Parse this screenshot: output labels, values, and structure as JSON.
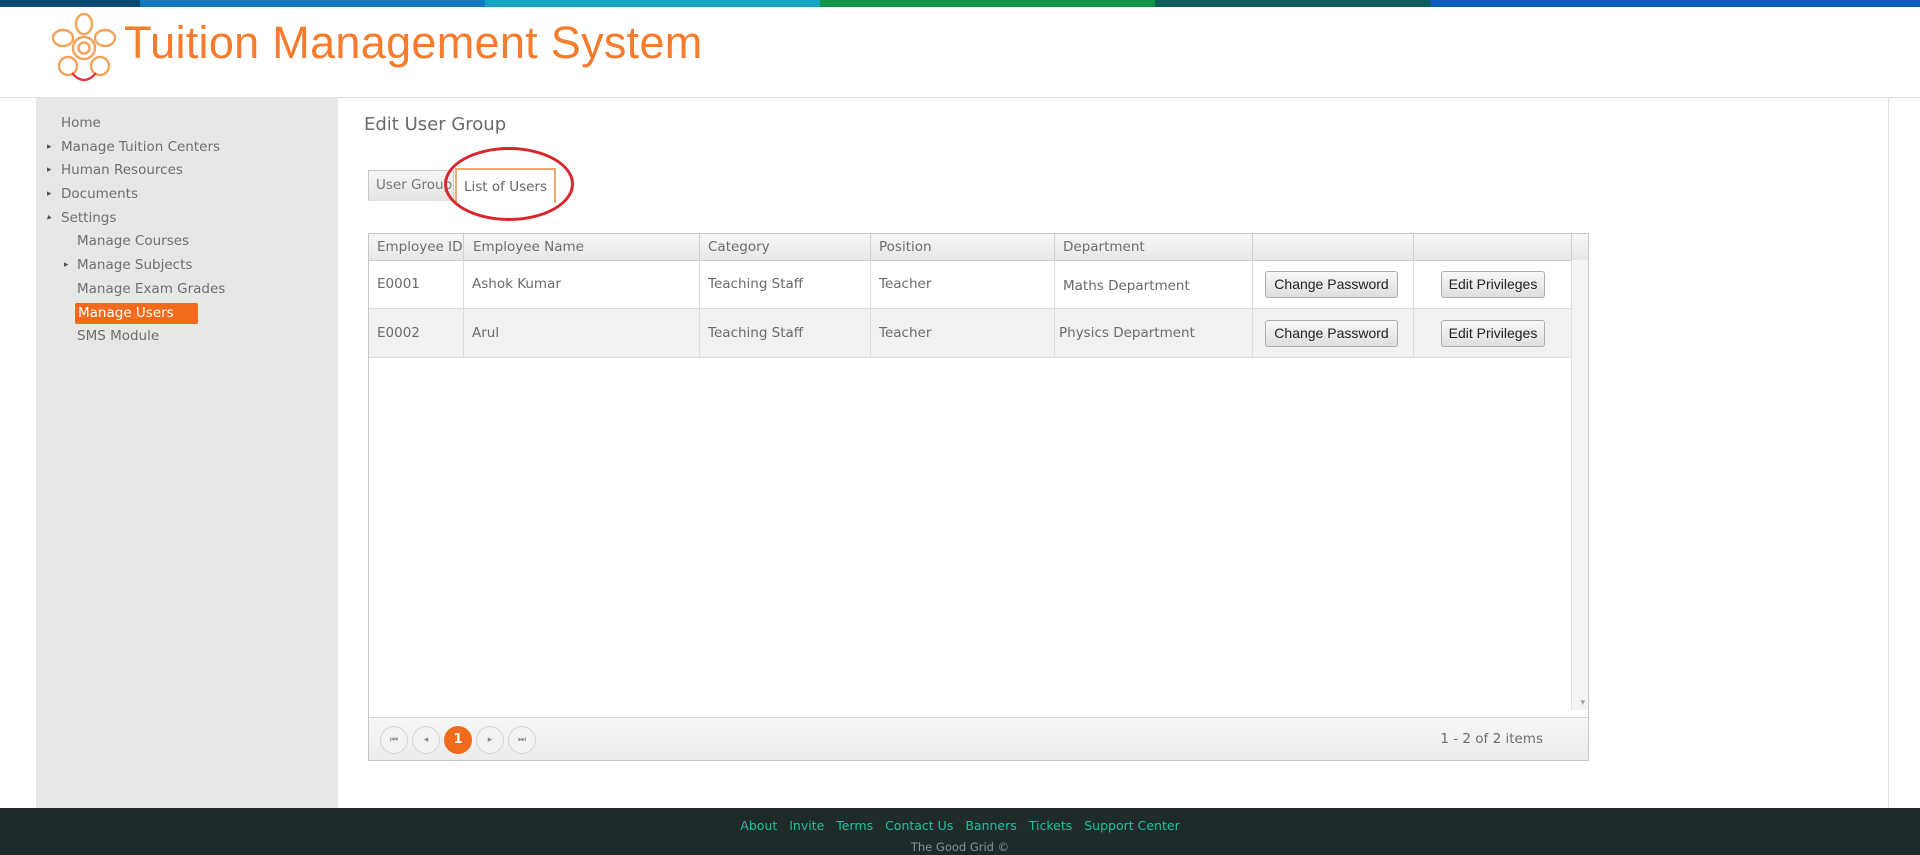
{
  "brand": {
    "title": "Tuition Management System",
    "accent_color": "#f47c2c",
    "top_strip_colors": [
      "#0a4a6e",
      "#1277bf",
      "#17a3c4",
      "#0f9448",
      "#0d5e59",
      "#0c5fbf"
    ]
  },
  "sidebar": {
    "items": [
      {
        "label": "Home",
        "arrow": ""
      },
      {
        "label": "Manage Tuition Centers",
        "arrow": "▸"
      },
      {
        "label": "Human Resources",
        "arrow": "▸"
      },
      {
        "label": "Documents",
        "arrow": "▸"
      },
      {
        "label": "Settings",
        "arrow": "◂"
      },
      {
        "label": "Manage Courses",
        "arrow": ""
      },
      {
        "label": "Manage Subjects",
        "arrow": "▸"
      },
      {
        "label": "Manage Exam Grades",
        "arrow": ""
      },
      {
        "label": "Manage Users",
        "arrow": ""
      },
      {
        "label": "SMS Module",
        "arrow": ""
      }
    ],
    "active_item": "Manage Users"
  },
  "main": {
    "page_title": "Edit User Group",
    "tabs": [
      {
        "label": "User Group"
      },
      {
        "label": "List of Users"
      }
    ],
    "selected_tab": "List of Users"
  },
  "grid": {
    "columns": [
      "Employee ID",
      "Employee Name",
      "Category",
      "Position",
      "Department",
      "",
      ""
    ],
    "rows": [
      {
        "id": "E0001",
        "name": "Ashok Kumar",
        "category": "Teaching Staff",
        "position": "Teacher",
        "department": "Maths Department",
        "change_password": "Change Password",
        "edit_privileges": "Edit Privileges"
      },
      {
        "id": "E0002",
        "name": "Arul",
        "category": "Teaching Staff",
        "position": "Teacher",
        "department": "Physics Department",
        "change_password": "Change Password",
        "edit_privileges": "Edit Privileges"
      }
    ],
    "pager": {
      "current_page": "1",
      "info": "1 - 2 of 2 items",
      "first_icon": "first-page-icon",
      "prev_icon": "prev-page-icon",
      "next_icon": "next-page-icon",
      "last_icon": "last-page-icon"
    }
  },
  "footer": {
    "links": [
      "About",
      "Invite",
      "Terms",
      "Contact Us",
      "Banners",
      "Tickets",
      "Support Center"
    ],
    "copyright": "The Good Grid ©"
  }
}
